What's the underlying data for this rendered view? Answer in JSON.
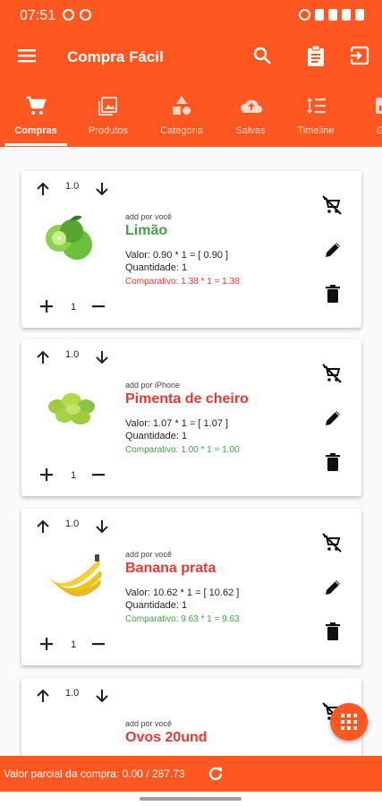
{
  "status_bar": {
    "time": "07:51",
    "left_icons": [
      "whatsapp-icon",
      "pinwheel-icon"
    ],
    "right_icons": [
      "alarm-icon",
      "bluetooth-icon",
      "wifi-icon",
      "signal-icon",
      "battery-icon"
    ]
  },
  "app_bar": {
    "title": "Compra Fácil",
    "actions": [
      "search-icon",
      "clipboard-icon",
      "exit-icon"
    ]
  },
  "tabs": [
    {
      "label": "Compras",
      "icon": "cart-icon",
      "active": true
    },
    {
      "label": "Produtos",
      "icon": "image-icon",
      "active": false
    },
    {
      "label": "Categoria",
      "icon": "category-icon",
      "active": false
    },
    {
      "label": "Salvas",
      "icon": "cloud-upload-icon",
      "active": false
    },
    {
      "label": "Timeline",
      "icon": "sort-icon",
      "active": false
    },
    {
      "label": "Gra",
      "icon": "chart-icon",
      "active": false
    }
  ],
  "items": [
    {
      "score": "1.0",
      "added_by": "add por você",
      "name": "Limão",
      "name_color": "#43a047",
      "valor": "Valor: 0.90 * 1 = [ 0.90 ]",
      "quantidade": "Quantidade: 1",
      "comparativo": "Comparativo: 1.38 * 1  = 1.38",
      "comparativo_color": "#e53935",
      "qty": "1"
    },
    {
      "score": "1.0",
      "added_by": "add por iPhone",
      "name": "Pimenta de cheiro",
      "name_color": "#e53935",
      "valor": "Valor: 1.07 * 1 = [ 1.07 ]",
      "quantidade": "Quantidade: 1",
      "comparativo": "Comparativo: 1.00 * 1  = 1.00",
      "comparativo_color": "#43a047",
      "qty": "1"
    },
    {
      "score": "1.0",
      "added_by": "add por você",
      "name": "Banana prata",
      "name_color": "#e53935",
      "valor": "Valor: 10.62 * 1 = [ 10.62 ]",
      "quantidade": "Quantidade: 1",
      "comparativo": "Comparativo: 9.63 * 1  = 9.63",
      "comparativo_color": "#43a047",
      "qty": "1"
    },
    {
      "score": "1.0",
      "added_by": "add por você",
      "name": "Ovos 20und",
      "name_color": "#e53935",
      "valor": "",
      "quantidade": "",
      "comparativo": "",
      "comparativo_color": "#43a047",
      "qty": ""
    }
  ],
  "bottom_bar": {
    "partial_label": "Valor parcial da compra: 0.00 / 287.73"
  },
  "colors": {
    "primary": "#ff5722",
    "green": "#43a047",
    "red": "#e53935"
  }
}
